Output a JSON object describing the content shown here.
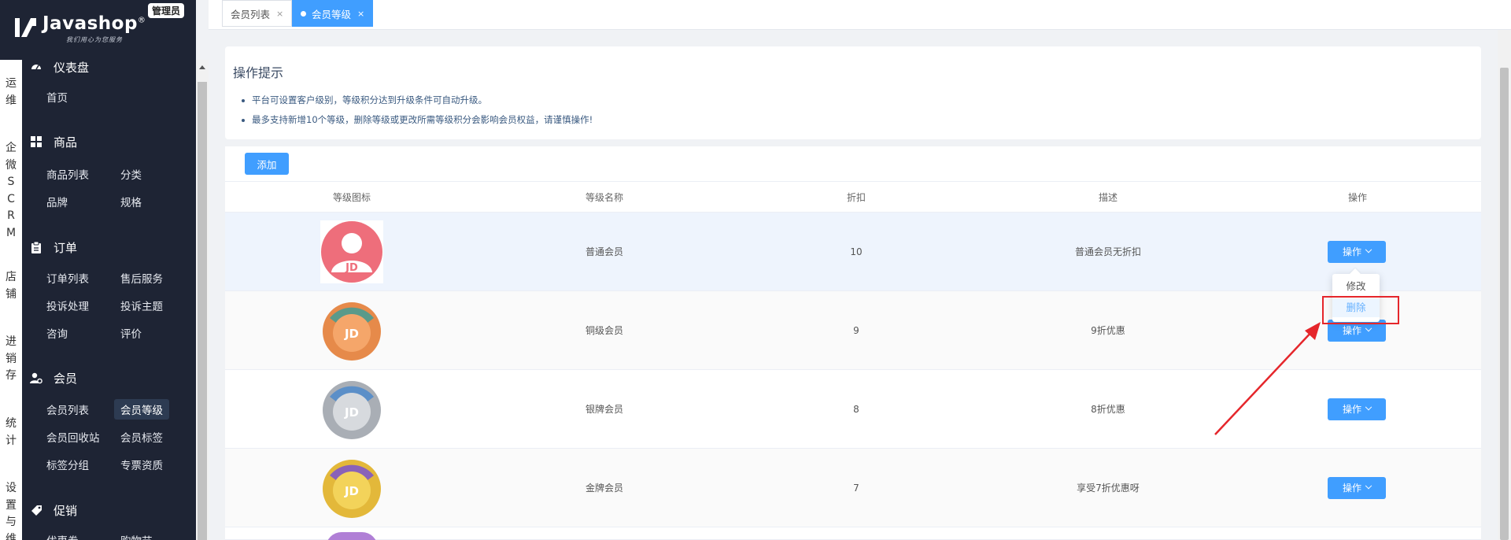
{
  "brand": {
    "name": "Javashop",
    "reg_mark": "®",
    "slogan": "我们用心为您服务",
    "badge": "管理员"
  },
  "vertical_nav": [
    {
      "label": "运维"
    },
    {
      "label": "企微SCRM"
    },
    {
      "label": "店铺"
    },
    {
      "label": "进销存"
    },
    {
      "label": "统计"
    },
    {
      "label": "设置与维"
    }
  ],
  "menu": {
    "dashboard": {
      "title": "仪表盘",
      "icon": "dashboard-icon",
      "items": [
        "首页"
      ]
    },
    "goods": {
      "title": "商品",
      "icon": "grid-icon",
      "items": [
        "商品列表",
        "分类",
        "品牌",
        "规格"
      ]
    },
    "orders": {
      "title": "订单",
      "icon": "clipboard-icon",
      "items": [
        "订单列表",
        "售后服务",
        "投诉处理",
        "投诉主题",
        "咨询",
        "评价"
      ]
    },
    "members": {
      "title": "会员",
      "icon": "user-gear-icon",
      "items": [
        "会员列表",
        "会员等级",
        "会员回收站",
        "会员标签",
        "标签分组",
        "专票资质"
      ],
      "active": "会员等级"
    },
    "promotion": {
      "title": "促销",
      "icon": "tag-icon",
      "items": [
        "优惠券",
        "购物节"
      ]
    }
  },
  "tabs": [
    {
      "label": "会员列表",
      "close": "×",
      "active": false
    },
    {
      "label": "会员等级",
      "close": "×",
      "active": true
    }
  ],
  "tips": {
    "title": "操作提示",
    "items": [
      "平台可设置客户级别，等级积分达到升级条件可自动升级。",
      "最多支持新增10个等级，删除等级或更改所需等级积分会影响会员权益，请谨慎操作!"
    ]
  },
  "table": {
    "add_label": "添加",
    "columns": [
      "等级图标",
      "等级名称",
      "折扣",
      "描述",
      "操作"
    ],
    "rows": [
      {
        "name": "普通会员",
        "discount": "10",
        "desc": "普通会员无折扣",
        "action": "操作",
        "icon": "pink-user-jd-icon"
      },
      {
        "name": "铜级会员",
        "discount": "9",
        "desc": "9折优惠",
        "action": "操作",
        "icon": "bronze-jd-badge-icon"
      },
      {
        "name": "银牌会员",
        "discount": "8",
        "desc": "8折优惠",
        "action": "操作",
        "icon": "silver-jd-badge-icon"
      },
      {
        "name": "金牌会员",
        "discount": "7",
        "desc": "享受7折优惠呀",
        "action": "操作",
        "icon": "gold-jd-badge-icon"
      }
    ]
  },
  "dropdown": {
    "items": [
      "修改",
      "删除"
    ],
    "highlighted": "删除"
  },
  "colors": {
    "primary": "#409eff",
    "sidebar_bg": "#1e2434",
    "annotation_red": "#e5262b"
  }
}
